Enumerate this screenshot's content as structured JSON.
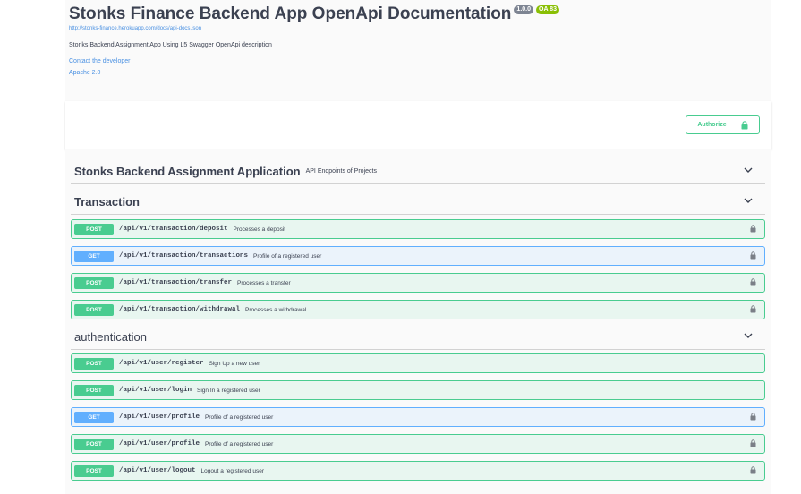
{
  "info": {
    "title": "Stonks Finance Backend App OpenApi Documentation",
    "version_badge": "1.0.0",
    "oas_badge": "OA 83",
    "spec_url": "http://stonks-finance.herokuapp.com/docs/api-docs.json",
    "description": "Stonks Backend Assignment App Using L5 Swagger OpenApi description",
    "contact_link": "Contact the developer",
    "license_link": "Apache 2.0"
  },
  "scheme": {
    "authorize_label": "Authorize"
  },
  "tags": [
    {
      "name": "Stonks Backend Assignment Application",
      "description": "API Endpoints of Projects"
    },
    {
      "name": "Transaction",
      "description": ""
    },
    {
      "name": "authentication",
      "description": ""
    }
  ],
  "operations": [
    {
      "method": "POST",
      "path": "/api/v1/transaction/deposit",
      "summary": "Processes a deposit",
      "locked": true
    },
    {
      "method": "GET",
      "path": "/api/v1/transaction/transactions",
      "summary": "Profile of a registered user",
      "locked": true
    },
    {
      "method": "POST",
      "path": "/api/v1/transaction/transfer",
      "summary": "Processes a transfer",
      "locked": true
    },
    {
      "method": "POST",
      "path": "/api/v1/transaction/withdrawal",
      "summary": "Processes a withdrawal",
      "locked": true
    },
    {
      "method": "POST",
      "path": "/api/v1/user/register",
      "summary": "Sign Up a new user",
      "locked": false
    },
    {
      "method": "POST",
      "path": "/api/v1/user/login",
      "summary": "Sign In a registered user",
      "locked": false
    },
    {
      "method": "GET",
      "path": "/api/v1/user/profile",
      "summary": "Profile of a registered user",
      "locked": true
    },
    {
      "method": "POST",
      "path": "/api/v1/user/profile",
      "summary": "Profile of a registered user",
      "locked": true
    },
    {
      "method": "POST",
      "path": "/api/v1/user/logout",
      "summary": "Logout a registered user",
      "locked": true
    }
  ],
  "colors": {
    "post": "#49cc90",
    "get": "#61affe",
    "link": "#4990e2"
  },
  "icons": {
    "lock": "lock-icon",
    "chevron": "chevron-down-icon"
  }
}
